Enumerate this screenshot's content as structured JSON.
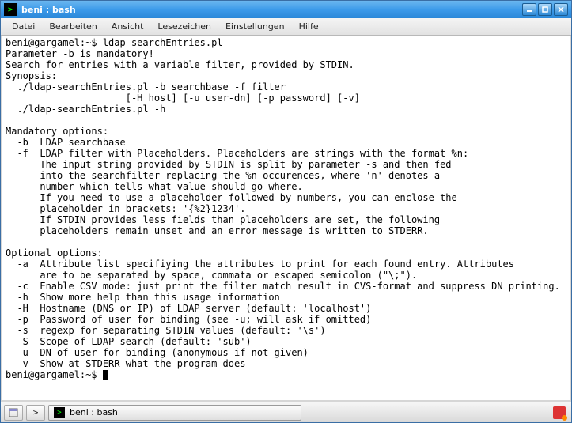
{
  "window": {
    "title": "beni : bash"
  },
  "menubar": {
    "items": [
      "Datei",
      "Bearbeiten",
      "Ansicht",
      "Lesezeichen",
      "Einstellungen",
      "Hilfe"
    ]
  },
  "terminal": {
    "prompt1": "beni@gargamel:~$ ",
    "command1": "ldap-searchEntries.pl",
    "lines": [
      "Parameter -b is mandatory!",
      "Search for entries with a variable filter, provided by STDIN.",
      "Synopsis:",
      "  ./ldap-searchEntries.pl -b searchbase -f filter",
      "                     [-H host] [-u user-dn] [-p password] [-v]",
      "  ./ldap-searchEntries.pl -h",
      "",
      "Mandatory options:",
      "  -b  LDAP searchbase",
      "  -f  LDAP filter with Placeholders. Placeholders are strings with the format %n:",
      "      The input string provided by STDIN is split by parameter -s and then fed",
      "      into the searchfilter replacing the %n occurences, where 'n' denotes a",
      "      number which tells what value should go where.",
      "      If you need to use a placeholder followed by numbers, you can enclose the",
      "      placeholder in brackets: '{%2}1234'.",
      "      If STDIN provides less fields than placeholders are set, the following",
      "      placeholders remain unset and an error message is written to STDERR.",
      "",
      "Optional options:",
      "  -a  Attribute list specifiying the attributes to print for each found entry. Attributes",
      "      are to be separated by space, commata or escaped semicolon (\"\\;\").",
      "  -c  Enable CSV mode: just print the filter match result in CVS-format and suppress DN printing.",
      "  -h  Show more help than this usage information",
      "  -H  Hostname (DNS or IP) of LDAP server (default: 'localhost')",
      "  -p  Password of user for binding (see -u; will ask if omitted)",
      "  -s  regexp for separating STDIN values (default: '\\s')",
      "  -S  Scope of LDAP search (default: 'sub')",
      "  -u  DN of user for binding (anonymous if not given)",
      "  -v  Show at STDERR what the program does"
    ],
    "prompt2": "beni@gargamel:~$ "
  },
  "taskbar": {
    "active_task": "beni : bash"
  }
}
